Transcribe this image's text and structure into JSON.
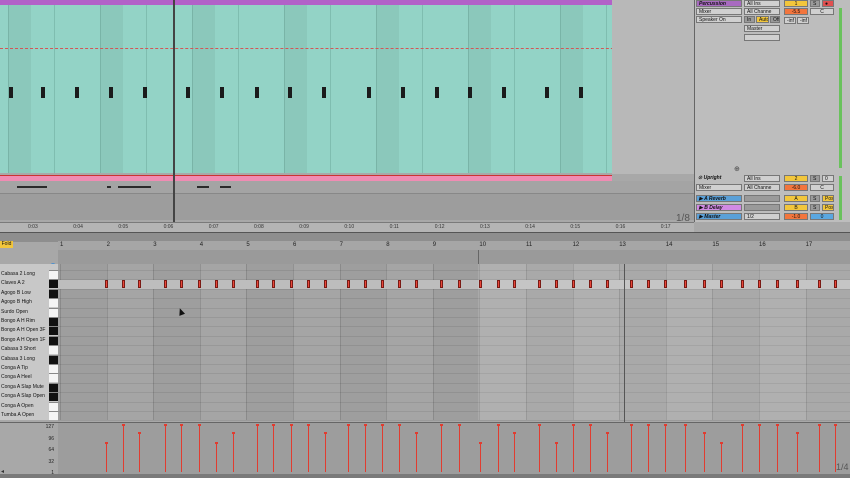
{
  "arrangement": {
    "ruler_labels": [
      "0:03",
      "0:04",
      "0:05",
      "0:06",
      "0:07",
      "0:08",
      "0:09",
      "0:10",
      "0:11",
      "0:12",
      "0:13",
      "0:14",
      "0:15",
      "0:16",
      "0:17"
    ],
    "quantize": "1/8"
  },
  "mixer": {
    "percussion": {
      "name": "Percussion",
      "input": "All Ins",
      "device": "Mixer",
      "channel": "All Channe",
      "monitor": "Speaker On",
      "monitor_in": "In",
      "monitor_auto": "Auto",
      "monitor_off": "Off",
      "output": "Master",
      "track_num": "1",
      "volume": "-5.5",
      "pan": "C",
      "inf1": "-inf",
      "inf2": "-inf",
      "solo": "S"
    },
    "upright": {
      "name": "Upright",
      "input": "All Ins",
      "device": "Mixer",
      "channel": "All Channe",
      "track_num": "2",
      "volume": "-6.0",
      "pan": "C",
      "solo": "S",
      "arm": "0"
    },
    "returns": [
      {
        "name": "A Reverb",
        "letter": "A",
        "solo": "S",
        "post": "Post"
      },
      {
        "name": "B Delay",
        "letter": "B",
        "solo": "S",
        "post": "Post"
      }
    ],
    "master": {
      "name": "Master",
      "output": "1/2",
      "volume": "-1.0",
      "pan": "0"
    }
  },
  "clip": {
    "fold_label": "Fold",
    "bar_numbers": [
      "1",
      "2",
      "3",
      "4",
      "5",
      "6",
      "7",
      "8",
      "9",
      "10",
      "11",
      "12",
      "13",
      "14",
      "15",
      "16",
      "17"
    ],
    "keys": [
      "Cabasa 2 Long",
      "Claves A 2",
      "Agogo B Low",
      "Agogo B High",
      "Surdo Open",
      "Bongo A H Rim",
      "Bongo A H Open 3F",
      "Bongo A H Open 1F",
      "Cabasa 3 Short",
      "Cabasa 3 Long",
      "Conga A Tip",
      "Conga A Heel",
      "Conga A Slap Mute",
      "Conga A Slap Open",
      "Conga A Open",
      "Tumba A Open"
    ],
    "velocity_labels": [
      "127",
      "96",
      "64",
      "32",
      "1"
    ],
    "velocity_quantize": "1/4"
  },
  "colors": {
    "clip_teal": "#93d3c6",
    "clip_purple": "#b261c8",
    "note_red": "#e8473a",
    "pink": "#f08cb3"
  }
}
